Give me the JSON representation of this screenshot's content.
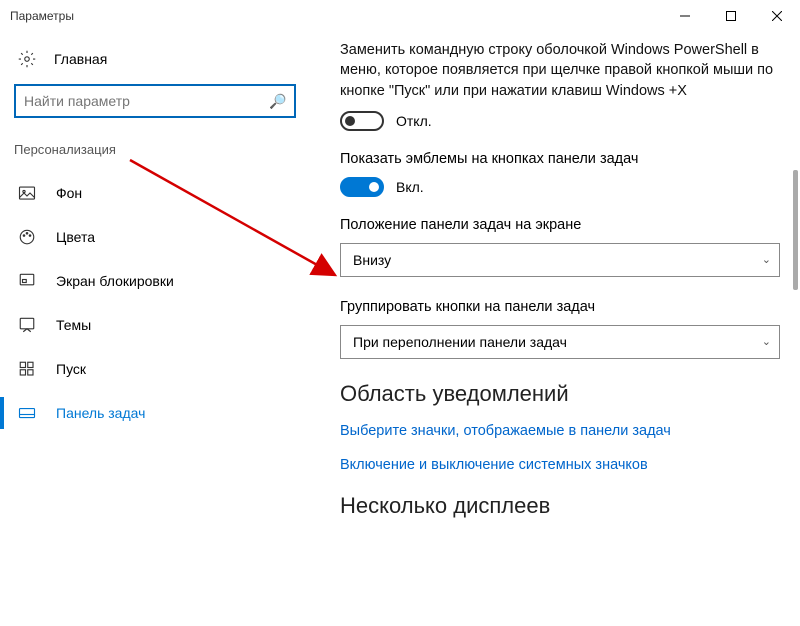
{
  "window": {
    "title": "Параметры"
  },
  "sidebar": {
    "home": "Главная",
    "search_placeholder": "Найти параметр",
    "category": "Персонализация",
    "items": [
      {
        "label": "Фон"
      },
      {
        "label": "Цвета"
      },
      {
        "label": "Экран блокировки"
      },
      {
        "label": "Темы"
      },
      {
        "label": "Пуск"
      },
      {
        "label": "Панель задач"
      }
    ]
  },
  "content": {
    "powershell_desc": "Заменить командную строку оболочкой Windows PowerShell в меню, которое появляется при щелчке правой кнопкой мыши по кнопке \"Пуск\" или при нажатии клавиш Windows +X",
    "toggle_off_label": "Откл.",
    "badges_label": "Показать эмблемы на кнопках панели задач",
    "toggle_on_label": "Вкл.",
    "position_label": "Положение панели задач на экране",
    "position_value": "Внизу",
    "group_label": "Группировать кнопки на панели задач",
    "group_value": "При переполнении панели задач",
    "notif_heading": "Область уведомлений",
    "link1": "Выберите значки, отображаемые в панели задач",
    "link2": "Включение и выключение системных значков",
    "displays_heading": "Несколько дисплеев"
  }
}
